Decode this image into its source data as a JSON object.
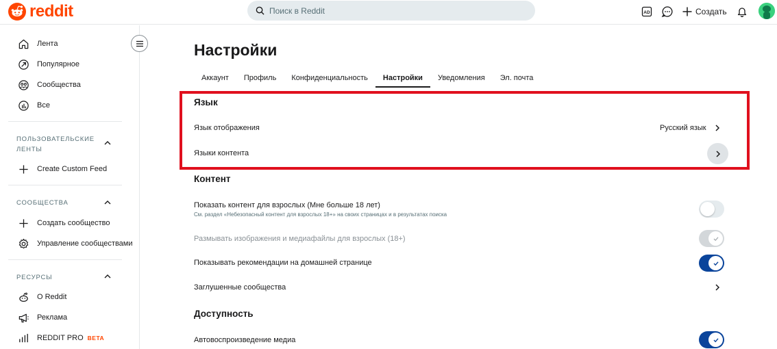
{
  "header": {
    "logo_text": "reddit",
    "search_placeholder": "Поиск в Reddit",
    "create_label": "Создать",
    "icons": [
      "ad-icon",
      "chat-icon",
      "plus-icon",
      "bell-icon"
    ],
    "brand_color": "#ff4500"
  },
  "sidebar": {
    "main_items": [
      {
        "label": "Лента",
        "icon": "home-icon"
      },
      {
        "label": "Популярное",
        "icon": "popular-icon"
      },
      {
        "label": "Сообщества",
        "icon": "communities-icon"
      },
      {
        "label": "Все",
        "icon": "all-icon"
      }
    ],
    "custom_feeds": {
      "title": "ПОЛЬЗОВАТЕЛЬСКИЕ ЛЕНТЫ",
      "create_label": "Create Custom Feed"
    },
    "communities": {
      "title": "СООБЩЕСТВА",
      "create_label": "Создать сообщество",
      "manage_label": "Управление сообществами"
    },
    "resources": {
      "title": "РЕСУРСЫ",
      "about_label": "О Reddit",
      "ads_label": "Реклама",
      "pro_label": "REDDIT PRO",
      "pro_badge": "BETA"
    }
  },
  "main": {
    "title": "Настройки",
    "tabs": [
      {
        "label": "Аккаунт",
        "active": false
      },
      {
        "label": "Профиль",
        "active": false
      },
      {
        "label": "Конфиденциальность",
        "active": false
      },
      {
        "label": "Настройки",
        "active": true
      },
      {
        "label": "Уведомления",
        "active": false
      },
      {
        "label": "Эл. почта",
        "active": false
      }
    ],
    "language": {
      "title": "Язык",
      "display_label": "Язык отображения",
      "display_value": "Русский язык",
      "content_label": "Языки контента"
    },
    "content": {
      "title": "Контент",
      "nsfw_label": "Показать контент для взрослых (Мне больше 18 лет)",
      "nsfw_sub": "См. раздел «Небезопасный контент для взрослых 18+» на своих страницах и в результатах поиска",
      "nsfw_on": false,
      "blur_label": "Размывать изображения и медиафайлы для взрослых (18+)",
      "blur_on": true,
      "blur_disabled": true,
      "recs_label": "Показывать рекомендации на домашней странице",
      "recs_on": true,
      "muted_label": "Заглушенные сообщества"
    },
    "accessibility": {
      "title": "Доступность",
      "autoplay_label": "Автовоспроизведение медиа",
      "autoplay_on": true
    }
  },
  "colors": {
    "toggle_on": "#0a449b",
    "highlight": "#e0101e"
  }
}
